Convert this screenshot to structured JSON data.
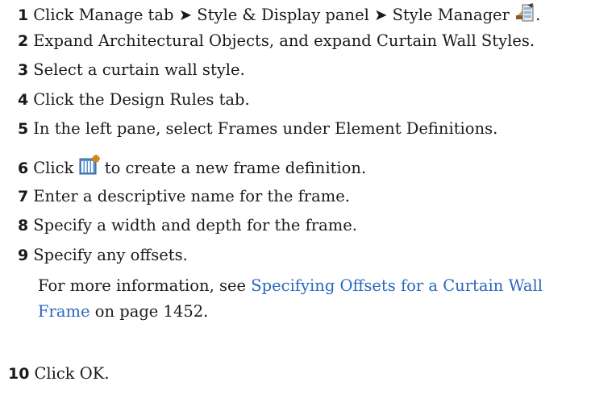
{
  "steps": [
    {
      "num": "1",
      "text": "Click Manage tab ➤ Style & Display panel ➤ Style Manager",
      "suffix": "."
    },
    {
      "num": "2",
      "text": "Expand Architectural Objects, and expand Curtain Wall Styles."
    },
    {
      "num": "3",
      "text": "Select a curtain wall style."
    },
    {
      "num": "4",
      "text": "Click the Design Rules tab."
    },
    {
      "num": "5",
      "text": "In the left pane, select Frames under Element Definitions."
    },
    {
      "num": "6",
      "prefix": "Click",
      "text": "to create a new frame definition."
    },
    {
      "num": "7",
      "text": "Enter a descriptive name for the frame."
    },
    {
      "num": "8",
      "text": "Specify a width and depth for the frame."
    },
    {
      "num": "9",
      "text": "Specify any offsets."
    },
    {
      "num": "10",
      "text": "Click OK."
    }
  ],
  "note": {
    "prefix": "For more information, see",
    "link_line1": "Specifying Offsets for a Curtain Wall",
    "link_line2": "Frame",
    "suffix": "on page 1452."
  },
  "icons": {
    "step1": "style-manager-icon",
    "step6": "new-frame-definition-icon"
  },
  "colors": {
    "link": "#2a66c0",
    "text": "#1a1a1a"
  }
}
